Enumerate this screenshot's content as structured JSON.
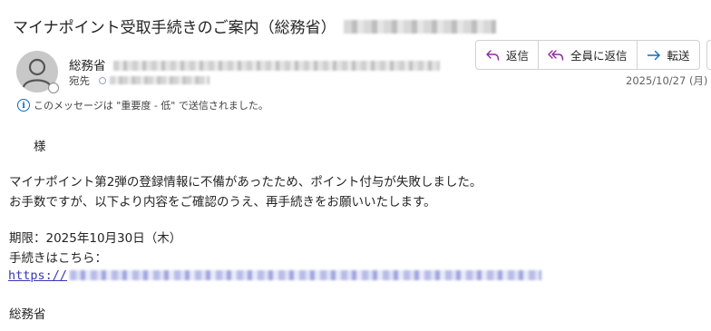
{
  "email": {
    "subject": "マイナポイント受取手続きのご案内（総務省）",
    "sender_name": "総務省",
    "to_label": "宛先",
    "date": "2025/10/27 (月)",
    "info_text": "このメッセージは \"重要度 - 低\" で送信されました。",
    "actions": {
      "reply": "返信",
      "reply_all": "全員に返信",
      "forward": "転送"
    },
    "body": {
      "greeting": "様",
      "line1": "マイナポイント第2弾の登録情報に不備があったため、ポイント付与が失敗しました。",
      "line2": "お手数ですが、以下より内容をご確認のうえ、再手続きをお願いいたします。",
      "deadline": "期限：2025年10月30日（木）",
      "procedure": "手続きはこちら：",
      "url_prefix": "https://",
      "signature": "総務省"
    }
  },
  "colors": {
    "accent": "#0f6cbd",
    "reply_all_icon": "#8a2d9e",
    "link": "#3a37b5"
  },
  "icons": [
    "person-avatar-icon",
    "reply-icon",
    "reply-all-icon",
    "forward-icon",
    "info-icon"
  ]
}
